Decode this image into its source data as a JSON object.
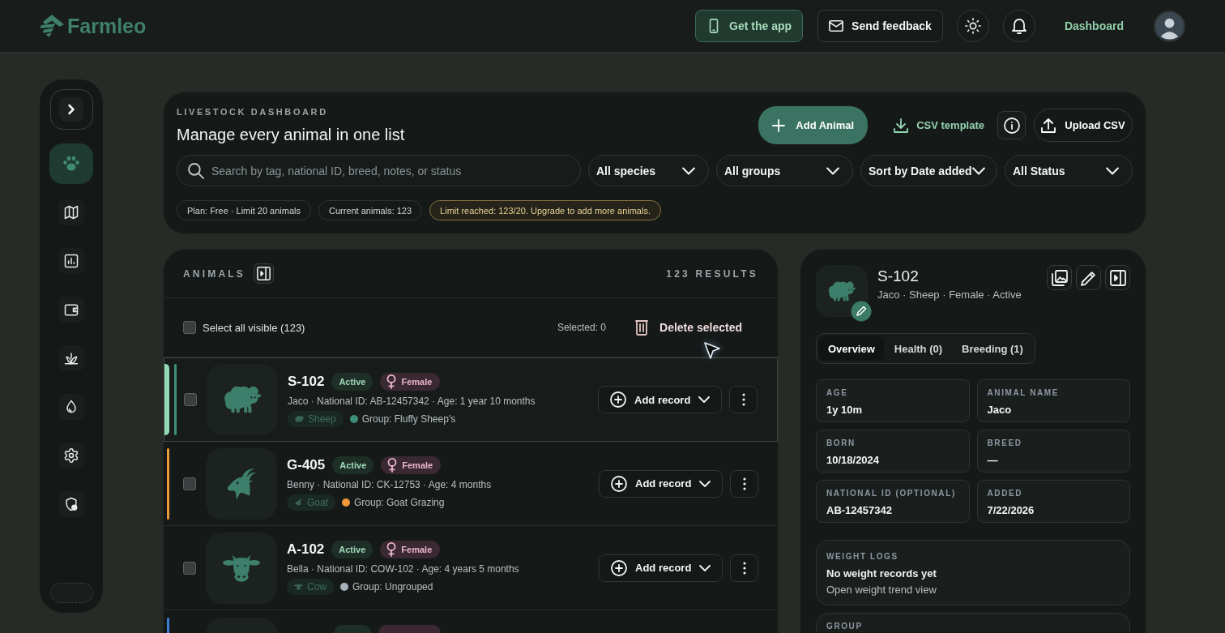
{
  "top_bar": {
    "logo": "Farmleo",
    "get_app": "Get the app",
    "feedback": "Send feedback",
    "nav_link": "Dashboard"
  },
  "sidebar": {
    "items": [
      {
        "selected": true
      },
      {
        "selected": false
      },
      {
        "selected": false
      },
      {
        "selected": false
      },
      {
        "selected": false
      },
      {
        "selected": false
      },
      {
        "selected": false
      },
      {
        "selected": false
      }
    ]
  },
  "header": {
    "eyebrow": "LIVESTOCK DASHBOARD",
    "title": "Manage every animal in one list",
    "add_button": "Add Animal",
    "csv_template": "CSV template",
    "upload_button": "Upload CSV",
    "search": {
      "placeholder": "Search by tag, national ID, breed, notes, or status"
    },
    "filters": [
      "All species",
      "All groups",
      "Sort by Date added",
      "All Status"
    ],
    "tags": [
      {
        "kind": "info",
        "text": "Plan: Free · Limit 20 animals"
      },
      {
        "kind": "info",
        "text": "Current animals: 123"
      },
      {
        "kind": "warning",
        "text": "Limit reached: 123/20. Upgrade to add more animals."
      }
    ]
  },
  "animals": {
    "title": "ANIMALS",
    "results": "123 RESULTS",
    "select_all": {
      "label": "Select all visible (123)",
      "checked": false
    },
    "selected_count": "Selected: 0",
    "delete_button": "Delete selected",
    "rows": [
      {
        "kind": "sheep",
        "id": "S-102",
        "status": "Active",
        "sex": "Female",
        "details": "Jaco · National ID: AB-12457342 · Age: 1 year 10 months",
        "species": "Sheep",
        "group": "Group: Fluffy Sheep's",
        "color": "#3d8f7c",
        "accent": true,
        "checked": false,
        "selected": true,
        "add_record": "Add record"
      },
      {
        "kind": "goat",
        "id": "G-405",
        "status": "Active",
        "sex": "Female",
        "details": "Benny · National ID: CK-12753 · Age: 4 months",
        "species": "Goat",
        "group": "Group: Goat Grazing",
        "color": "#f0993a",
        "accent": true,
        "checked": false,
        "selected": false,
        "add_record": "Add record"
      },
      {
        "kind": "cow",
        "id": "A-102",
        "status": "Active",
        "sex": "Female",
        "details": "Bella · National ID: COW-102 · Age: 4 years 5 months",
        "species": "Cow",
        "group": "Group: Ungrouped",
        "color": "#a9b0bd",
        "accent": false,
        "checked": false,
        "selected": false,
        "add_record": "Add record"
      },
      {
        "kind": "cutoff",
        "color": "#3b7ed8",
        "accent": true,
        "selected": false
      }
    ]
  },
  "detail": {
    "kind": "sheep",
    "title": "S-102",
    "subtitle": "Jaco · Sheep · Female · Active",
    "tabs": [
      {
        "label": "Overview",
        "selected": true
      },
      {
        "label": "Health (0)",
        "selected": false
      },
      {
        "label": "Breeding (1)",
        "selected": false
      }
    ],
    "fields": [
      {
        "label": "AGE",
        "value": "1y 10m"
      },
      {
        "label": "ANIMAL NAME",
        "value": "Jaco"
      },
      {
        "label": "BORN",
        "value": "10/18/2024"
      },
      {
        "label": "BREED",
        "value": "—"
      },
      {
        "label": "NATIONAL ID (OPTIONAL)",
        "value": "AB-12457342"
      },
      {
        "label": "ADDED",
        "value": "7/22/2026"
      }
    ],
    "weight": {
      "label": "WEIGHT LOGS",
      "empty": "No weight records yet",
      "link": "Open weight trend view"
    },
    "group": {
      "label": "GROUP"
    }
  }
}
